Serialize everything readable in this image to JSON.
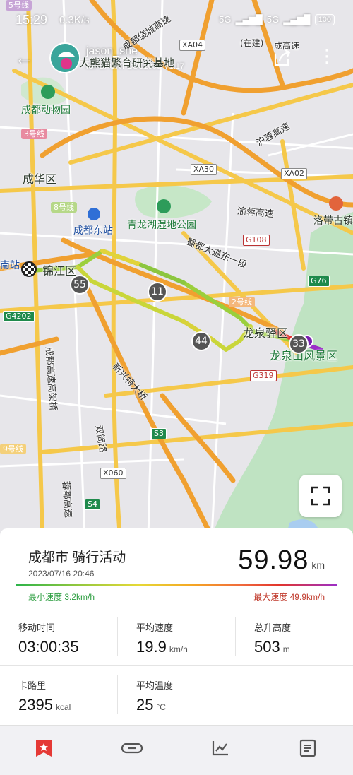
{
  "status_bar": {
    "time": "15:29",
    "speed": "0.3K/s",
    "network_1": "5G",
    "network_2": "5G",
    "battery": "100"
  },
  "header": {
    "user_name": "jason_she",
    "device_name": "iGPSPORT BSC100S  V1.17"
  },
  "map": {
    "places": [
      {
        "id": "zoo",
        "text": "成都动物园"
      },
      {
        "id": "panda",
        "text": "大熊猫繁育研究基地"
      },
      {
        "id": "chenghua",
        "text": "成华区"
      },
      {
        "id": "east-station",
        "text": "成都东站"
      },
      {
        "id": "jinjiang",
        "text": "锦江区"
      },
      {
        "id": "qinglong",
        "text": "青龙湖湿地公园"
      },
      {
        "id": "longquanyi",
        "text": "龙泉驿区"
      },
      {
        "id": "longquan-scenic",
        "text": "龙泉山风景区"
      },
      {
        "id": "luodai",
        "text": "洛带古镇"
      },
      {
        "id": "zaiajian",
        "text": "(在建)"
      },
      {
        "id": "chengdu-gaotie",
        "text": "成高速"
      },
      {
        "id": "south-station",
        "text": "南站"
      }
    ],
    "roads": [
      {
        "id": "raocheng",
        "text": "成都绕城高速"
      },
      {
        "id": "hurong",
        "text": "沪蓉高速"
      },
      {
        "id": "yurong",
        "text": "渝蓉高速"
      },
      {
        "id": "shudu",
        "text": "蜀都大道东一段"
      },
      {
        "id": "xinxing",
        "text": "新兴特大桥"
      },
      {
        "id": "shuangjian",
        "text": "双简路"
      },
      {
        "id": "chengdu-viaduct",
        "text": "成都高速高架桥"
      },
      {
        "id": "rongdu",
        "text": "蓉都高速"
      }
    ],
    "shields": [
      "XA04",
      "XA30",
      "XA02",
      "G108",
      "G76",
      "G4202",
      "G319",
      "S3",
      "X060",
      "S4"
    ],
    "metro_lines": [
      "5号线",
      "3号线",
      "8号线",
      "2号线",
      "9号线"
    ],
    "km_markers": [
      "55",
      "11",
      "44",
      "33"
    ]
  },
  "activity": {
    "title": "成都市 骑行活动",
    "date": "2023/07/16 20:46",
    "distance": "59.98",
    "distance_unit": "km",
    "min_speed": "最小速度 3.2km/h",
    "max_speed": "最大速度 49.9km/h"
  },
  "stats": {
    "moving_time": {
      "label": "移动时间",
      "value": "03:00:35",
      "unit": ""
    },
    "avg_speed": {
      "label": "平均速度",
      "value": "19.9",
      "unit": "km/h"
    },
    "total_ascent": {
      "label": "总升高度",
      "value": "503",
      "unit": "m"
    },
    "calories": {
      "label": "卡路里",
      "value": "2395",
      "unit": "kcal"
    },
    "avg_temp": {
      "label": "平均温度",
      "value": "25",
      "unit": "°C"
    }
  },
  "colors": {
    "accent": "#e53935",
    "route_start": "#2bb34a",
    "route_end": "#9b2ec9"
  },
  "nav": [
    "star-tab-icon",
    "link-tab-icon",
    "chart-tab-icon",
    "document-tab-icon"
  ]
}
